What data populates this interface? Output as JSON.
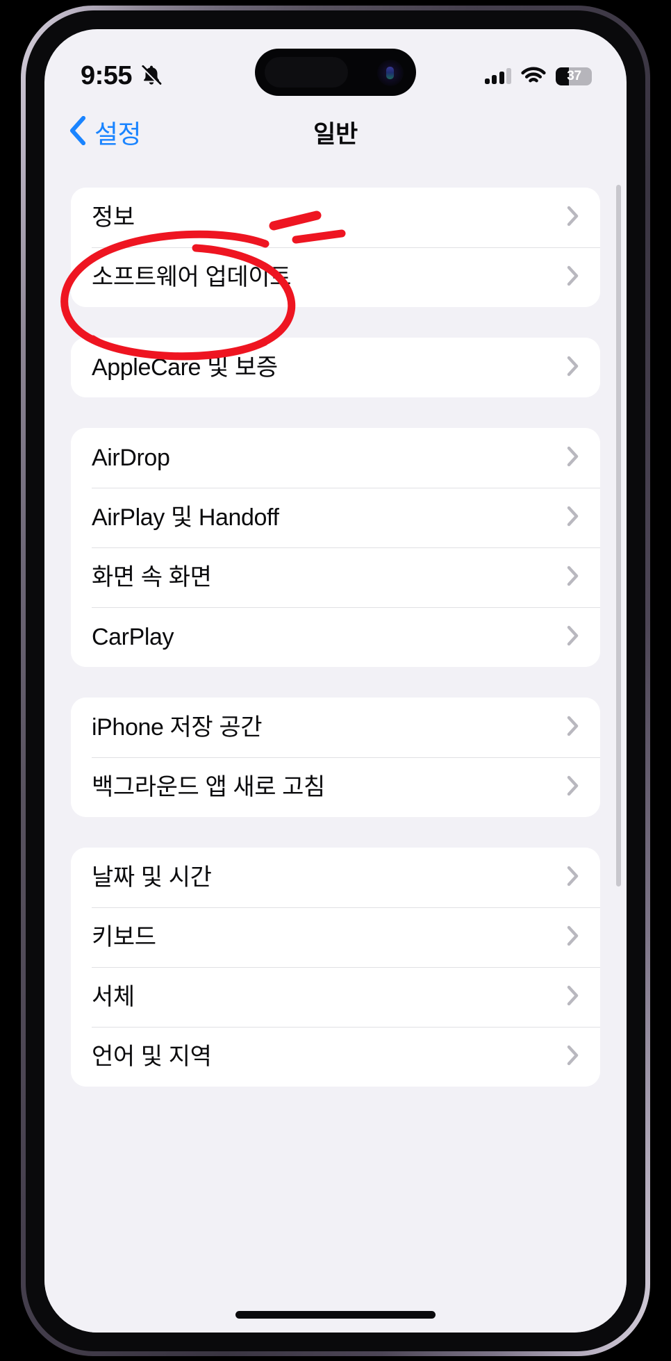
{
  "device": {
    "name": "iPhone",
    "frame_color": "#4a4452"
  },
  "status_bar": {
    "time": "9:55",
    "silent_icon": "bell-slash-icon",
    "signal_icon": "cellular-signal-icon",
    "signal_bars_filled": 3,
    "signal_bars_total": 4,
    "wifi_icon": "wifi-icon",
    "battery_percent": "37",
    "battery_level": 37
  },
  "nav": {
    "back_label": "설정",
    "back_icon": "chevron-left-icon",
    "title": "일반",
    "accent_color": "#1a84ff"
  },
  "groups": [
    {
      "id": "about-group",
      "rows": [
        {
          "label": "정보",
          "name": "row-about"
        },
        {
          "label": "소프트웨어 업데이트",
          "name": "row-software-update"
        }
      ]
    },
    {
      "id": "applecare-group",
      "rows": [
        {
          "label": "AppleCare 및 보증",
          "name": "row-applecare-warranty"
        }
      ]
    },
    {
      "id": "sharing-group",
      "rows": [
        {
          "label": "AirDrop",
          "name": "row-airdrop"
        },
        {
          "label": "AirPlay 및 Handoff",
          "name": "row-airplay-handoff"
        },
        {
          "label": "화면 속 화면",
          "name": "row-picture-in-picture"
        },
        {
          "label": "CarPlay",
          "name": "row-carplay"
        }
      ]
    },
    {
      "id": "storage-group",
      "rows": [
        {
          "label": "iPhone 저장 공간",
          "name": "row-iphone-storage"
        },
        {
          "label": "백그라운드 앱 새로 고침",
          "name": "row-background-app-refresh"
        }
      ]
    },
    {
      "id": "system-group",
      "rows": [
        {
          "label": "날짜 및 시간",
          "name": "row-date-time"
        },
        {
          "label": "키보드",
          "name": "row-keyboard"
        },
        {
          "label": "서체",
          "name": "row-fonts"
        },
        {
          "label": "언어 및 지역",
          "name": "row-language-region"
        }
      ]
    }
  ],
  "annotation": {
    "color": "#ee1521",
    "shapes": [
      "ellipse-around-software-update",
      "double-slash-mark"
    ],
    "target_row": "소프트웨어 업데이트"
  }
}
